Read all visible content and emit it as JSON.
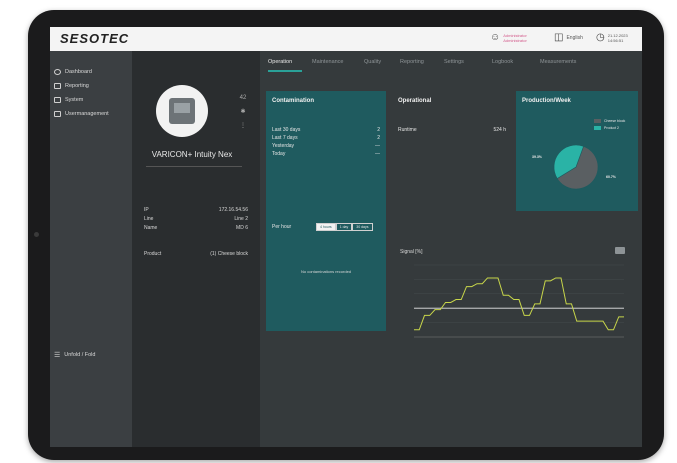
{
  "app": {
    "logo": "SESOTEC"
  },
  "topbar": {
    "user_line1": "Administrator",
    "user_line2": "Administrator",
    "language": "English",
    "date": "21.12.2023",
    "time": "14:56:51"
  },
  "sidebar": {
    "items": [
      {
        "label": "Dashboard",
        "icon": "clock-icon"
      },
      {
        "label": "Reporting",
        "icon": "report-icon"
      },
      {
        "label": "System",
        "icon": "system-icon"
      },
      {
        "label": "Usermanagement",
        "icon": "users-icon"
      }
    ],
    "collapse_label": "Unfold / Fold"
  },
  "device": {
    "name": "VARICON+ Intuity Nex",
    "side_value": "42",
    "details": [
      {
        "key": "IP",
        "value": "172.16.54.56"
      },
      {
        "key": "Line",
        "value": "Line 2"
      },
      {
        "key": "Name",
        "value": "MD 6"
      }
    ],
    "product_key": "Product",
    "product_value": "(1) Cheese block"
  },
  "tabs": [
    "Operation",
    "Maintenance",
    "Quality",
    "Reporting",
    "Settings",
    "Logbook",
    "Measurements"
  ],
  "contamination": {
    "title": "Contamination",
    "rows": [
      {
        "label": "Last 30 days",
        "value": "2"
      },
      {
        "label": "Last 7 days",
        "value": "2"
      },
      {
        "label": "Yesterday",
        "value": "—"
      },
      {
        "label": "Today",
        "value": "—"
      }
    ],
    "per_hour_label": "Per hour",
    "ranges": [
      "4 hours",
      "1 day",
      "30 days"
    ],
    "empty_text": "No contaminations recorded"
  },
  "operational": {
    "title": "Operational",
    "runtime_label": "Runtime",
    "runtime_value": "524 h"
  },
  "production": {
    "title": "Production/Week",
    "legend": [
      {
        "label": "Cheese block",
        "color": "#5a5f62"
      },
      {
        "label": "Product 2",
        "color": "#2ab3a6"
      }
    ]
  },
  "signal": {
    "label": "Signal [%]"
  },
  "chart_data": [
    {
      "type": "pie",
      "title": "Production/Week",
      "categories": [
        "Cheese block",
        "Product 2"
      ],
      "values": [
        60.7,
        39.3
      ],
      "labels": [
        "39.3%",
        "60.7%"
      ],
      "colors": [
        "#5a5f62",
        "#2ab3a6"
      ],
      "legend": "top-right"
    },
    {
      "type": "line",
      "title": "Signal [%]",
      "x": [
        0,
        1,
        2,
        3,
        4,
        5,
        6,
        7,
        8,
        9,
        10,
        11,
        12,
        13,
        14,
        15,
        16,
        17,
        18,
        19,
        20,
        21,
        22,
        23,
        24,
        25,
        26,
        27,
        28,
        29,
        30,
        31,
        32,
        33,
        34,
        35,
        36,
        37,
        38,
        39,
        40
      ],
      "values": [
        10,
        10,
        30,
        30,
        38,
        38,
        48,
        48,
        52,
        52,
        70,
        70,
        74,
        74,
        82,
        82,
        82,
        58,
        58,
        52,
        52,
        30,
        30,
        46,
        46,
        78,
        78,
        82,
        82,
        46,
        46,
        22,
        22,
        22,
        22,
        22,
        22,
        10,
        10,
        28,
        28
      ],
      "threshold": 40,
      "ylim": [
        0,
        100
      ],
      "grid": true
    }
  ]
}
